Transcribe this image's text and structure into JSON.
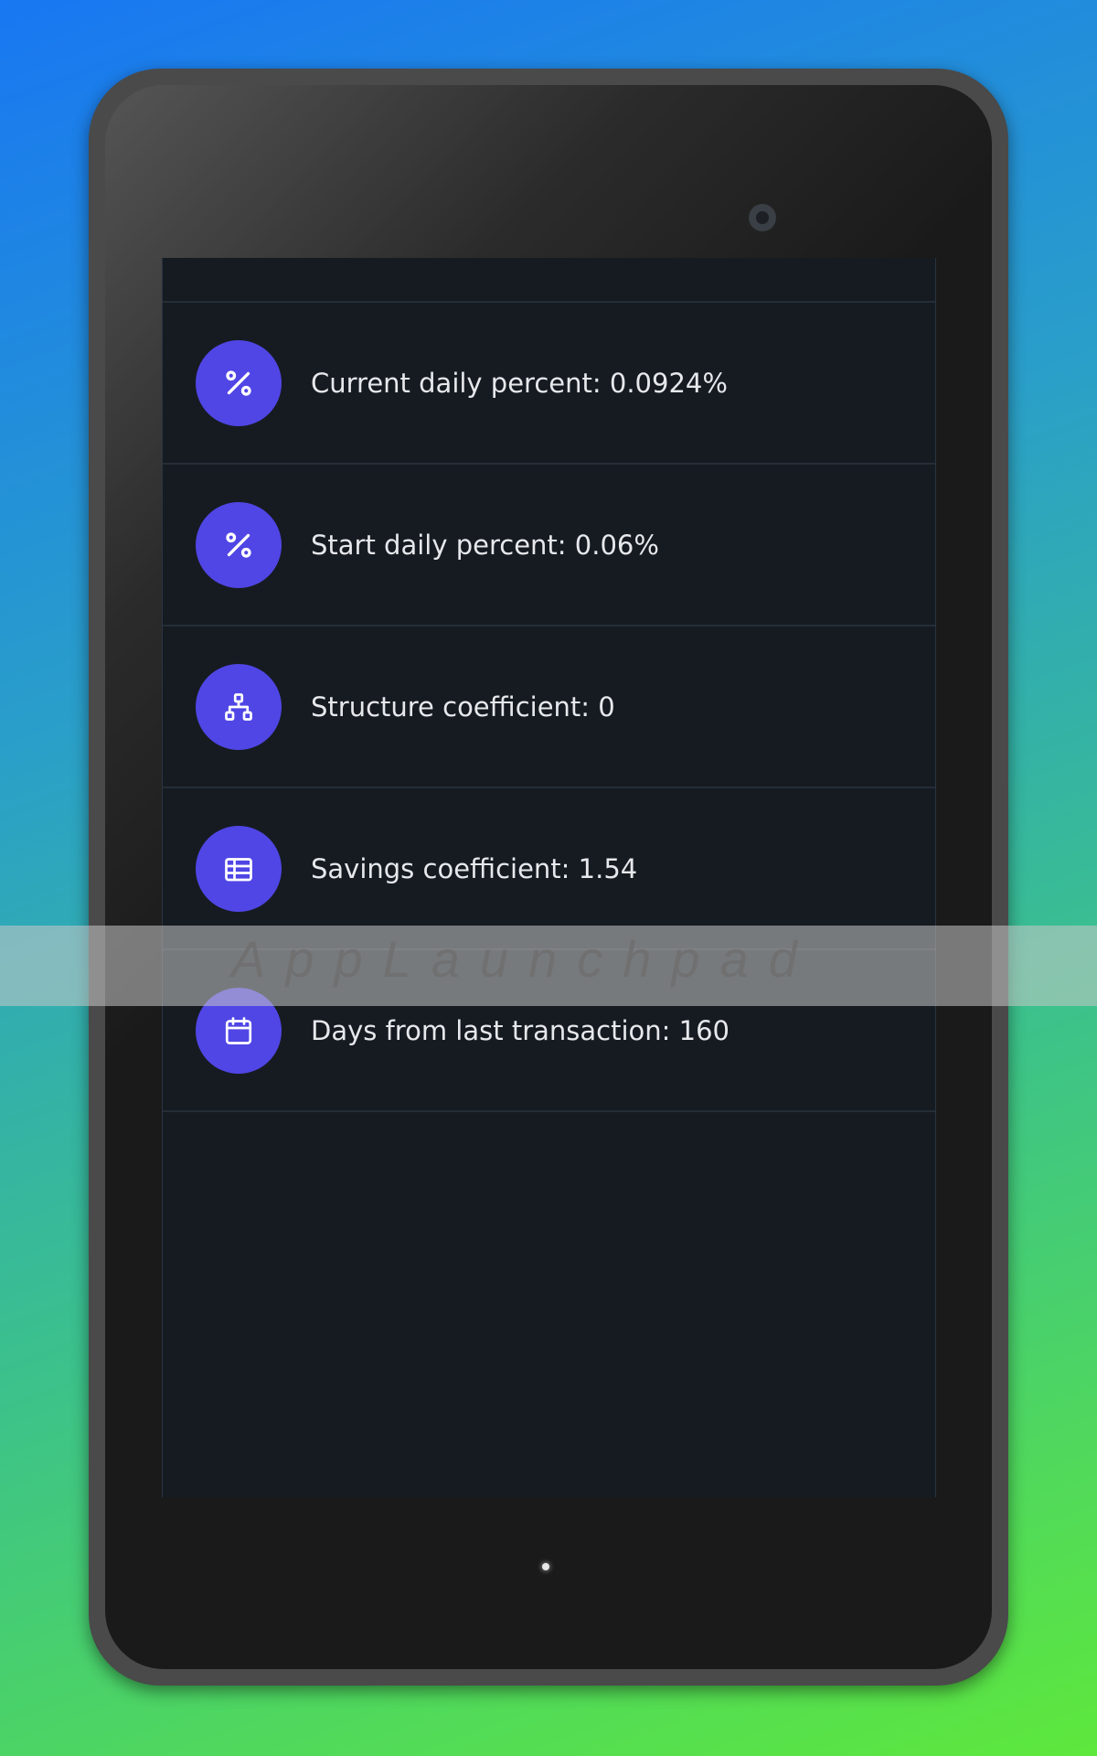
{
  "stats": {
    "items": [
      {
        "icon": "percent-icon",
        "label": "Current daily percent: 0.0924%"
      },
      {
        "icon": "percent-icon",
        "label": "Start daily percent: 0.06%"
      },
      {
        "icon": "hierarchy-icon",
        "label": "Structure coefficient: 0"
      },
      {
        "icon": "stacked-coins-icon",
        "label": "Savings coefficient: 1.54"
      },
      {
        "icon": "calendar-icon",
        "label": "Days from last transaction: 160"
      }
    ]
  },
  "watermark": {
    "text": "AppLaunchpad"
  },
  "colors": {
    "accent": "#5046e5",
    "screen_background": "#161b22",
    "divider": "#252d37",
    "text": "#e6e8eb"
  }
}
